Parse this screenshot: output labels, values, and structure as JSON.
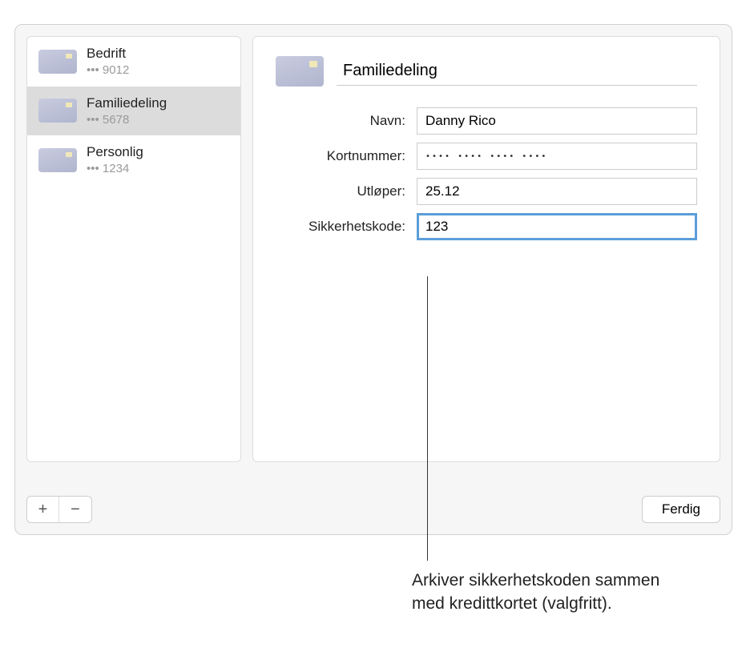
{
  "sidebar": {
    "items": [
      {
        "title": "Bedrift",
        "sub": "••• 9012",
        "selected": false
      },
      {
        "title": "Familiedeling",
        "sub": "••• 5678",
        "selected": true
      },
      {
        "title": "Personlig",
        "sub": "••• 1234",
        "selected": false
      }
    ]
  },
  "detail": {
    "title_value": "Familiedeling",
    "fields": {
      "name": {
        "label": "Navn:",
        "value": "Danny Rico"
      },
      "cardnumber": {
        "label": "Kortnummer:",
        "value": "•••• •••• •••• ••••"
      },
      "expires": {
        "label": "Utløper:",
        "value": "25.12"
      },
      "security": {
        "label": "Sikkerhetskode:",
        "value": "123"
      }
    }
  },
  "buttons": {
    "add": "+",
    "remove": "−",
    "done": "Ferdig"
  },
  "callout": "Arkiver sikkerhetskoden sammen med kredittkortet (valgfritt)."
}
